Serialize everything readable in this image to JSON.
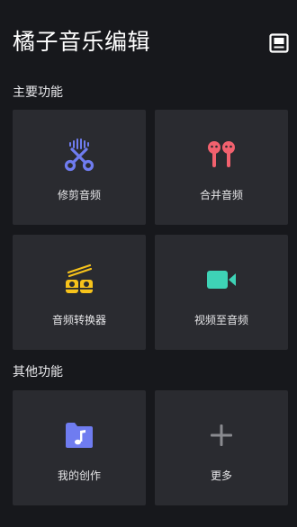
{
  "app": {
    "title": "橘子音乐编辑"
  },
  "sections": [
    {
      "title": "主要功能",
      "items": [
        {
          "label": "修剪音频",
          "icon": "scissors-icon",
          "color": "#6f7cf0"
        },
        {
          "label": "合并音频",
          "icon": "earbuds-icon",
          "color": "#f2616e"
        },
        {
          "label": "音频转换器",
          "icon": "sushi-roll-icon",
          "color": "#f7c31b"
        },
        {
          "label": "视频至音频",
          "icon": "video-camera-icon",
          "color": "#3ed3b6"
        }
      ]
    },
    {
      "title": "其他功能",
      "items": [
        {
          "label": "我的创作",
          "icon": "music-folder-icon",
          "color": "#6f7cf0"
        },
        {
          "label": "更多",
          "icon": "plus-icon",
          "color": "#8a8b90"
        }
      ]
    }
  ],
  "colors": {
    "background": "#17181c",
    "card": "#2a2b30",
    "text": "#e6e6e8"
  }
}
